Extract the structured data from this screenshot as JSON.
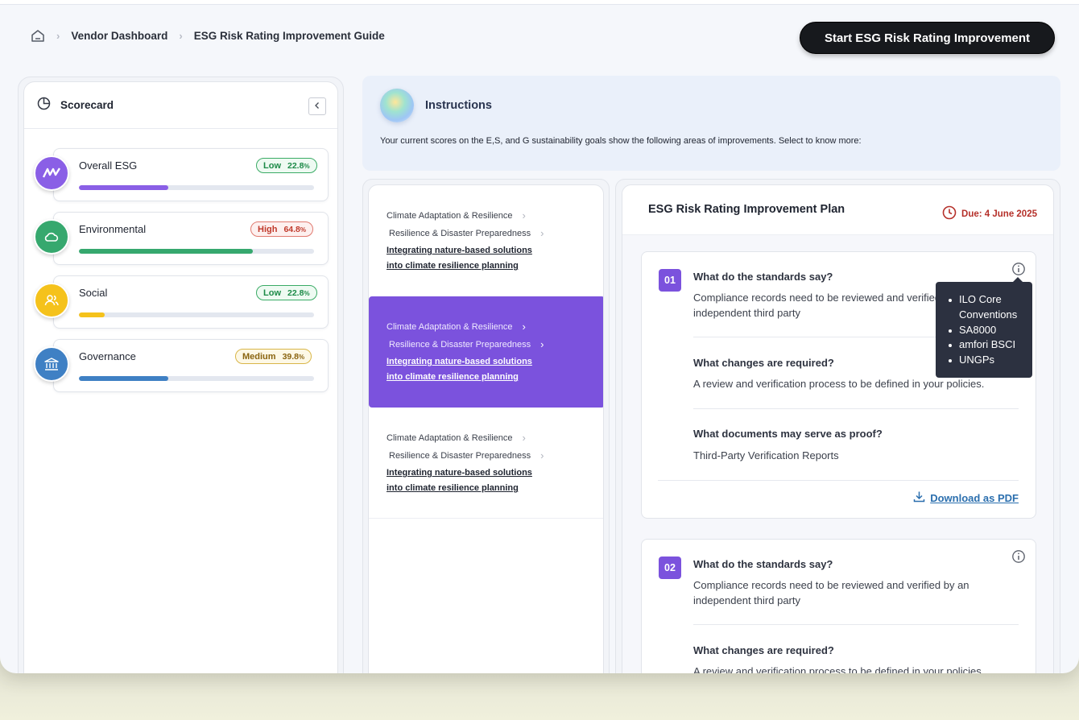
{
  "breadcrumb": {
    "home_icon": "home-icon",
    "items": [
      "Vendor Dashboard",
      "ESG Risk Rating Improvement Guide"
    ],
    "separator": ">"
  },
  "header": {
    "start_button": "Start ESG Risk Rating Improvement"
  },
  "scorecard": {
    "title": "Scorecard",
    "metrics": [
      {
        "name": "Overall ESG",
        "level": "Low",
        "percent": "22.8",
        "unit": "%",
        "value": 0.38,
        "color": "#8a5fe6",
        "icon": "waves-icon"
      },
      {
        "name": "Environmental",
        "level": "High",
        "percent": "64.8",
        "unit": "%",
        "value": 0.74,
        "color": "#36a86e",
        "icon": "cloud-icon"
      },
      {
        "name": "Social",
        "level": "Low",
        "percent": "22.8",
        "unit": "%",
        "value": 0.11,
        "color": "#f5c21b",
        "icon": "people-icon"
      },
      {
        "name": "Governance",
        "level": "Medium",
        "percent": "39.8",
        "unit": "%",
        "value": 0.38,
        "color": "#3f80c4",
        "icon": "bank-icon"
      }
    ]
  },
  "instructions": {
    "title": "Instructions",
    "text": "Your current scores on the E,S, and G sustainability goals show the following areas of improvements. Select to know more:"
  },
  "topics": [
    {
      "category": "Climate Adaptation & Resilience",
      "subcategory": "Resilience & Disaster Preparedness",
      "title_line1": "Integrating nature-based solutions",
      "title_line2": "into climate resilience planning",
      "selected": false
    },
    {
      "category": "Climate Adaptation & Resilience",
      "subcategory": "Resilience & Disaster Preparedness",
      "title_line1": "Integrating nature-based solutions",
      "title_line2": "into climate resilience planning",
      "selected": true
    },
    {
      "category": "Climate Adaptation & Resilience",
      "subcategory": "Resilience & Disaster Preparedness",
      "title_line1": "Integrating nature-based solutions",
      "title_line2": "into climate resilience planning",
      "selected": false
    }
  ],
  "plan": {
    "title": "ESG Risk Rating Improvement Plan",
    "due": "Due: 4 June 2025",
    "steps": [
      {
        "number": "01",
        "q1": "What do the standards say?",
        "a1_line1": "Compliance records need to be reviewed and verified by an",
        "a1_line2": "independent third party",
        "q2": "What changes are required?",
        "a2": "A review and verification process to be defined in your policies.",
        "q3": "What documents may serve as proof?",
        "a3": "Third-Party Verification Reports",
        "download": "Download as PDF"
      },
      {
        "number": "02",
        "q1": "What do the standards say?",
        "a1_line1": "Compliance records need to be reviewed and verified by an",
        "a1_line2": "independent third party",
        "q2": "What changes are required?",
        "a2": "A review and verification process to be defined in your policies."
      }
    ]
  },
  "tooltip": {
    "items": [
      "ILO Core",
      "Conventions",
      "SA8000",
      "amfori BSCI",
      "UNGPs"
    ]
  }
}
